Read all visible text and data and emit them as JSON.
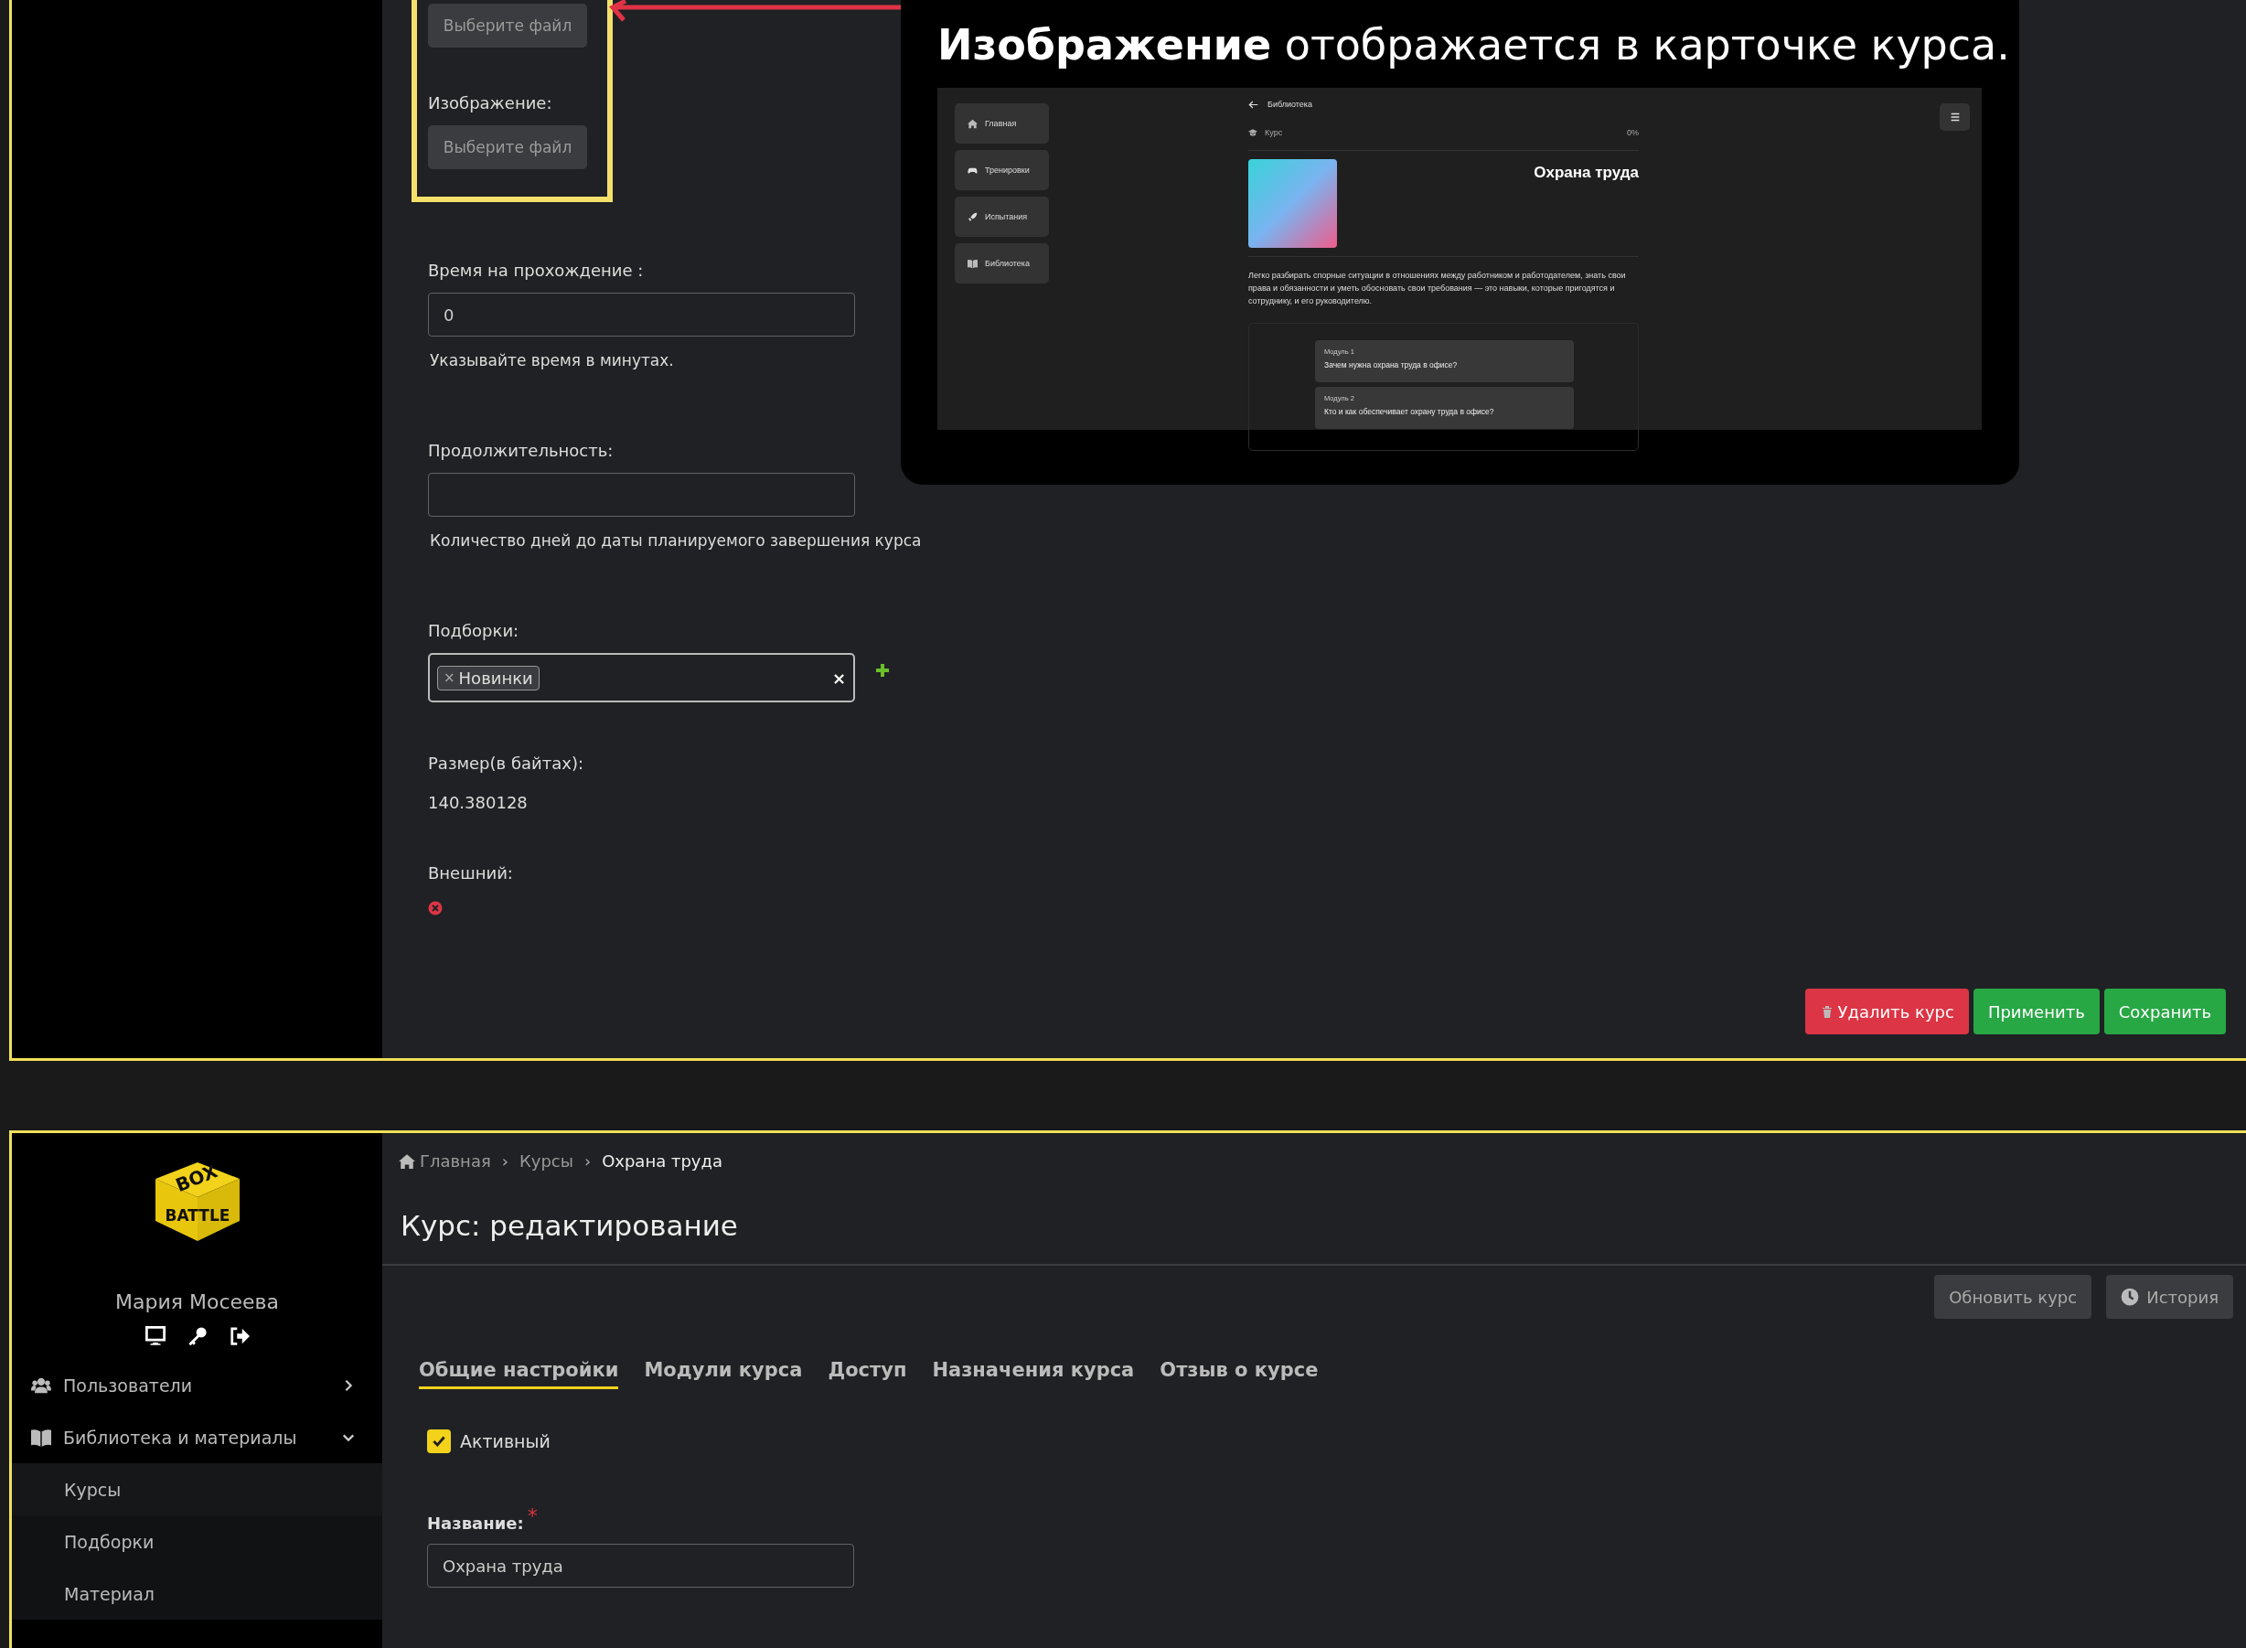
{
  "upper_form": {
    "fields": [
      {
        "kind": "file",
        "button": "Выберите файл"
      },
      {
        "kind": "file",
        "label": "Изображение:",
        "button": "Выберите файл"
      },
      {
        "kind": "text",
        "label": "Время на прохождение :",
        "value": "0",
        "hint": "Указывайте время в минутах."
      },
      {
        "kind": "text",
        "label": "Продолжительность:",
        "hint": "Количество дней до даты планируемого завершения курса"
      },
      {
        "kind": "tags",
        "label": "Подборки:",
        "tags": [
          {
            "remove": "×",
            "text": "Новинки"
          }
        ],
        "clear": "×"
      },
      {
        "kind": "static",
        "label": "Размер(в байтах):",
        "value": "140.380128"
      },
      {
        "kind": "bool",
        "label": "Внешний:",
        "on": false
      }
    ],
    "actions": [
      {
        "kind": "danger",
        "label": "Удалить курс"
      },
      {
        "kind": "success",
        "label": "Применить"
      },
      {
        "kind": "success",
        "label": "Сохранить"
      }
    ]
  },
  "callout": {
    "text": "**Изображение** отображается в карточке курса.",
    "preview": {
      "nav": [
        {
          "label": "Главная"
        },
        {
          "label": "Тренировки"
        },
        {
          "label": "Испытания"
        },
        {
          "label": "Библиотека"
        }
      ],
      "back": "Библиотека",
      "course_label": "Курс",
      "progress": "0%",
      "title": "Охрана труда",
      "description": "Легко разбирать спорные ситуации в отношениях между работником и работодателем, знать свои права и обязанности и уметь обосновать свои требования — это навыки, которые пригодятся и сотруднику, и его руководителю.",
      "modules": [
        {
          "number": "Модуль 1",
          "title": "Зачем нужна охрана труда в офисе?"
        },
        {
          "number": "Модуль 2",
          "title": "Кто и как обеспечивает охрану труда в офисе?"
        }
      ]
    }
  },
  "sidebar": {
    "logo": {
      "top": "BOX",
      "bottom": "BATTLE"
    },
    "user_name": "Мария Мосеева",
    "menu": [
      {
        "label": "Пользователи",
        "expanded": false
      },
      {
        "label": "Библиотека и материалы",
        "expanded": true,
        "children": [
          {
            "label": "Курсы",
            "selected": true
          },
          {
            "label": "Подборки",
            "selected": false
          },
          {
            "label": "Материал",
            "selected": false
          }
        ]
      }
    ]
  },
  "breadcrumb": [
    {
      "label": "Главная"
    },
    {
      "separator": "›",
      "label": "Курсы"
    },
    {
      "separator": "›",
      "label": "Охрана  труда"
    }
  ],
  "page_title": "Курс: редактирование",
  "header_buttons": [
    {
      "kind": "plain",
      "label": "Обновить курс"
    },
    {
      "kind": "history",
      "label": "История"
    }
  ],
  "tabs": [
    {
      "label": "Общие настройки",
      "selected": true
    },
    {
      "label": "Модули курса",
      "selected": false
    },
    {
      "label": "Доступ",
      "selected": false
    },
    {
      "label": "Назначения курса",
      "selected": false
    },
    {
      "label": "Отзыв о курсе",
      "selected": false
    }
  ],
  "active": {
    "label": "Активный",
    "checked": true
  },
  "name_field": {
    "label": "Название:",
    "required_mark": "*",
    "value": "Охрана труда"
  }
}
